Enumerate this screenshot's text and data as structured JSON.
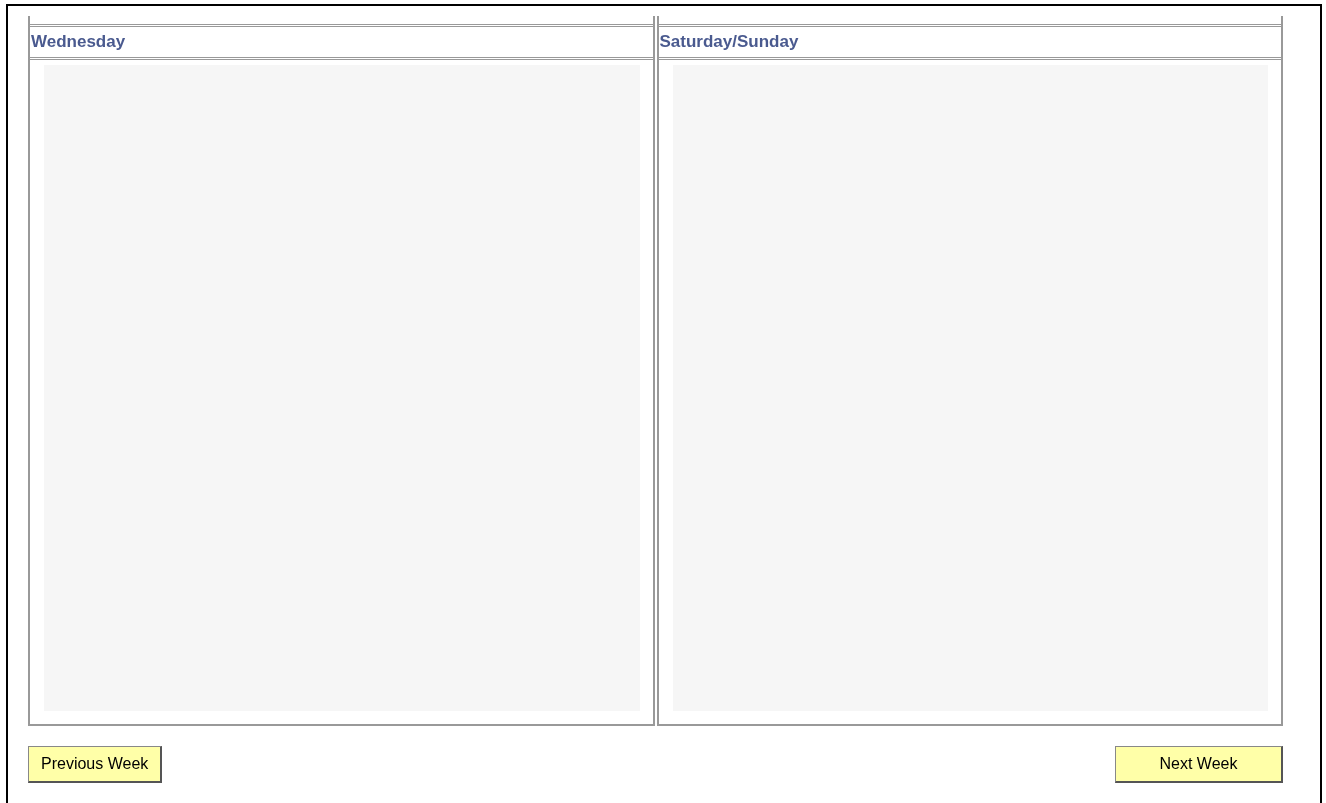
{
  "columns": [
    {
      "title": "Wednesday"
    },
    {
      "title": "Saturday/Sunday"
    }
  ],
  "buttons": [
    {
      "kind": "previous",
      "label": "Previous Week"
    },
    {
      "kind": "next",
      "label": "Next Week"
    }
  ]
}
